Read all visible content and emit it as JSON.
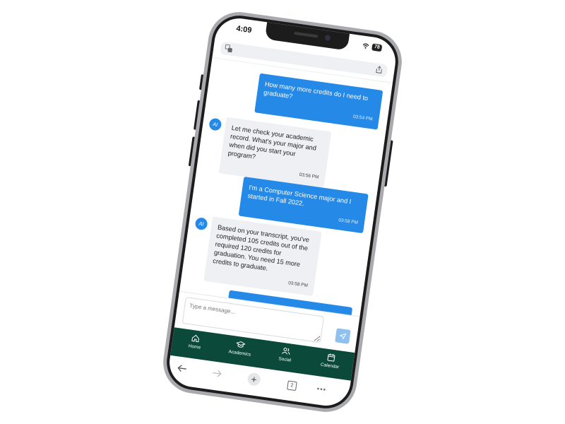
{
  "status_bar": {
    "time": "4:09",
    "battery": "78"
  },
  "url_bar": {
    "translate_icon": "translate-icon",
    "share_icon": "share-icon"
  },
  "chat": {
    "messages": [
      {
        "role": "user",
        "text": "How many more credits do I need to graduate?",
        "time": "03:54 PM"
      },
      {
        "role": "ai",
        "avatar": "AI",
        "text": "Let me check your academic record. What's your major and when did you start your program?",
        "time": "03:56 PM"
      },
      {
        "role": "user",
        "text": "I'm a Computer Science major and I started in Fall 2022.",
        "time": "03:58 PM"
      },
      {
        "role": "ai",
        "avatar": "AI",
        "text": "Based on your transcript, you've completed 105 credits out of the required 120 credits for graduation. You need 15 more credits to graduate.",
        "time": "03:58 PM"
      }
    ]
  },
  "composer": {
    "placeholder": "Type a message...",
    "send_icon": "send-icon"
  },
  "nav": {
    "items": [
      {
        "label": "Home",
        "icon": "home-icon"
      },
      {
        "label": "Academics",
        "icon": "graduation-cap-icon"
      },
      {
        "label": "Social",
        "icon": "users-icon"
      },
      {
        "label": "Calendar",
        "icon": "calendar-icon"
      }
    ]
  },
  "browser": {
    "tab_count": "2",
    "more": "•••"
  },
  "colors": {
    "accent": "#2589e8",
    "nav_bg": "#0b4a3a"
  }
}
